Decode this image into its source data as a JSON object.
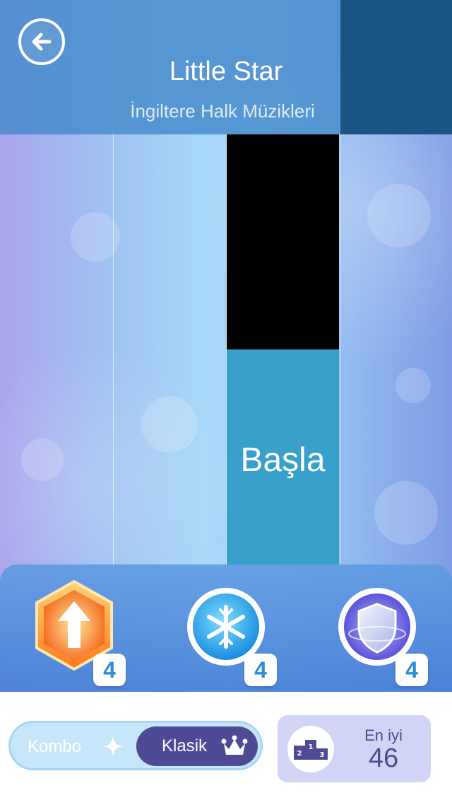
{
  "song": {
    "title": "Little Star",
    "subtitle": "İngiltere Halk Müzikleri"
  },
  "board": {
    "start_label": "Başla"
  },
  "powerups": [
    {
      "name": "speed-boost",
      "count": "4"
    },
    {
      "name": "freeze",
      "count": "4"
    },
    {
      "name": "shield",
      "count": "4"
    }
  ],
  "modes": {
    "kombo_label": "Kombo",
    "klasik_label": "Klasik",
    "selected": "Klasik"
  },
  "best": {
    "label": "En iyi",
    "value": "46"
  },
  "colors": {
    "header": "#488ccd",
    "header_dark": "#1a5585",
    "start_tile": "#37a1cb",
    "black_tile": "#000000",
    "mode_active": "#4e4a96",
    "best_bg": "#d2d4f6"
  },
  "icons": {
    "back": "arrow-left-icon",
    "speed": "arrow-up-hexagon-icon",
    "freeze": "snowflake-icon",
    "shield": "shield-icon",
    "sparkle": "sparkle-icon",
    "crown": "crown-icon",
    "podium": "podium-icon"
  }
}
